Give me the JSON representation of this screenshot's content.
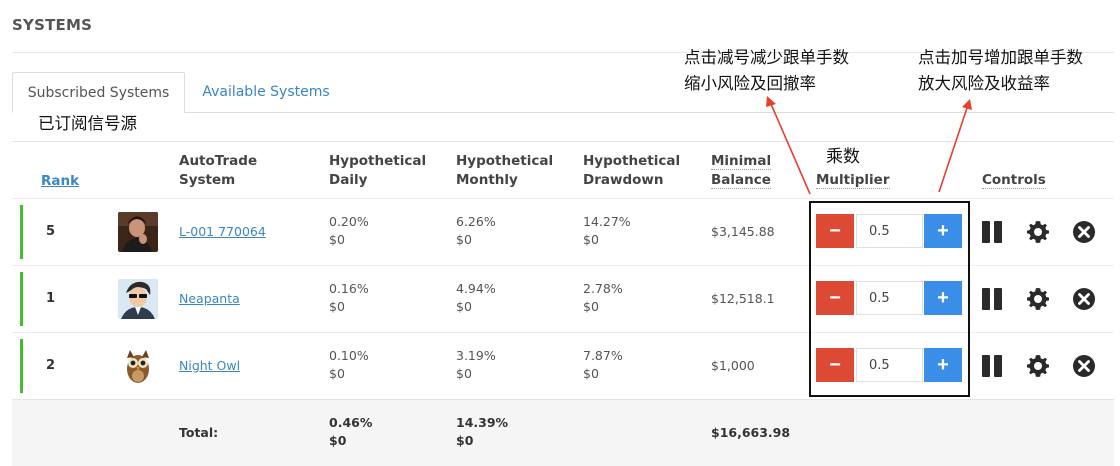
{
  "page": {
    "title": "SYSTEMS"
  },
  "tabs": [
    {
      "label": "Subscribed Systems",
      "active": true
    },
    {
      "label": "Available Systems",
      "active": false
    }
  ],
  "annotations": {
    "subscribed_note": "已订阅信号源",
    "multiplier_note": "乘数",
    "minus_note_line1": "点击减号减少跟单手数",
    "minus_note_line2": "缩小风险及回撤率",
    "plus_note_line1": "点击加号增加跟单手数",
    "plus_note_line2": "放大风险及收益率"
  },
  "columns": {
    "rank": "Rank",
    "system_line1": "AutoTrade",
    "system_line2": "System",
    "daily_line1": "Hypothetical",
    "daily_line2": "Daily",
    "monthly_line1": "Hypothetical",
    "monthly_line2": "Monthly",
    "drawdown_line1": "Hypothetical",
    "drawdown_line2": "Drawdown",
    "balance_line1": "Minimal",
    "balance_line2": "Balance",
    "multiplier": "Multiplier",
    "controls": "Controls"
  },
  "rows": [
    {
      "rank": "5",
      "system": "L-001 770064",
      "daily_pct": "0.20%",
      "daily_usd": "$0",
      "monthly_pct": "6.26%",
      "monthly_usd": "$0",
      "drawdown_pct": "14.27%",
      "drawdown_usd": "$0",
      "min_balance": "$3,145.88",
      "multiplier": "0.5",
      "avatar": "man-portrait-avatar"
    },
    {
      "rank": "1",
      "system": "Neapanta",
      "daily_pct": "0.16%",
      "daily_usd": "$0",
      "monthly_pct": "4.94%",
      "monthly_usd": "$0",
      "drawdown_pct": "2.78%",
      "drawdown_usd": "$0",
      "min_balance": "$12,518.1",
      "multiplier": "0.5",
      "avatar": "cartoon-man-sunglasses-avatar"
    },
    {
      "rank": "2",
      "system": "Night Owl",
      "daily_pct": "0.10%",
      "daily_usd": "$0",
      "monthly_pct": "3.19%",
      "monthly_usd": "$0",
      "drawdown_pct": "7.87%",
      "drawdown_usd": "$0",
      "min_balance": "$1,000",
      "multiplier": "0.5",
      "avatar": "owl-avatar"
    }
  ],
  "totals": {
    "label": "Total:",
    "daily_pct": "0.46%",
    "daily_usd": "$0",
    "monthly_pct": "14.39%",
    "monthly_usd": "$0",
    "min_balance": "$16,663.98"
  },
  "buttons": {
    "minus": "−",
    "plus": "+"
  },
  "icons": [
    "pause-icon",
    "gear-icon",
    "close-circle-icon",
    "minus-icon",
    "plus-icon"
  ],
  "colors": {
    "accent_link": "#3a87c8",
    "active_bar": "#43bd2b",
    "minus_btn": "#dc4a36",
    "plus_btn": "#3a8ee8",
    "annotation_arrow": "#e8402c"
  }
}
